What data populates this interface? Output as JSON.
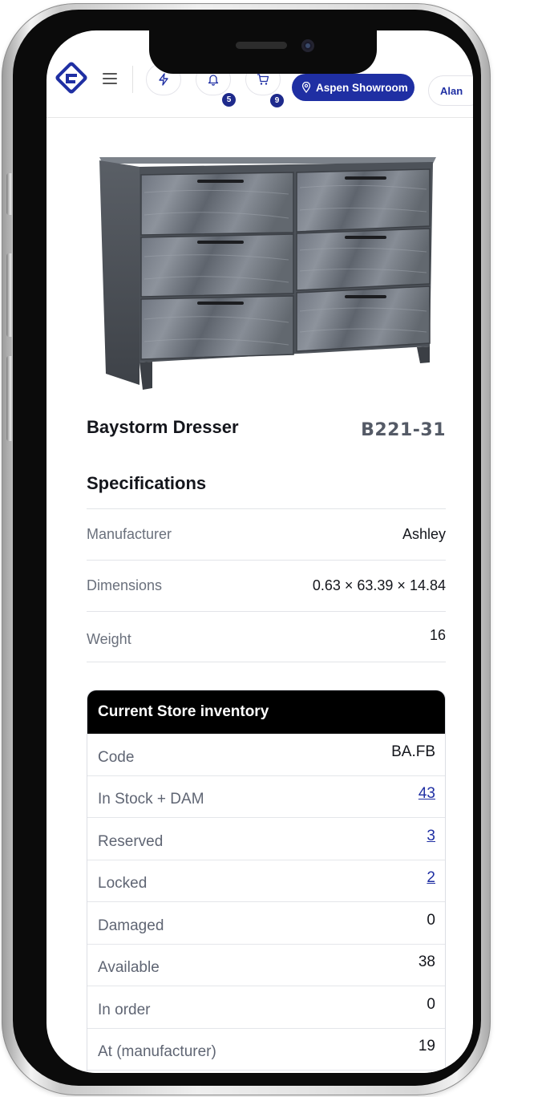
{
  "topbar": {
    "showroom_label": "Aspen Showroom",
    "user_label": "Alan",
    "notifications_count": "5",
    "cart_count": "9"
  },
  "product": {
    "name": "Baystorm Dresser",
    "code": "B221-31"
  },
  "specifications": {
    "title": "Specifications",
    "rows": [
      {
        "label": "Manufacturer",
        "value": "Ashley"
      },
      {
        "label": "Dimensions",
        "value": "0.63 × 63.39 × 14.84"
      },
      {
        "label": "Weight",
        "value": "16"
      }
    ]
  },
  "inventory": {
    "title": "Current Store inventory",
    "rows": [
      {
        "label": "Code",
        "value": "BA.FB"
      },
      {
        "label": "In Stock + DAM",
        "value": "43"
      },
      {
        "label": "Reserved",
        "value": "3"
      },
      {
        "label": "Locked",
        "value": "2"
      },
      {
        "label": "Damaged",
        "value": "0"
      },
      {
        "label": "Available",
        "value": "38"
      },
      {
        "label": "In order",
        "value": "0"
      },
      {
        "label": "At (manufacturer)",
        "value": "19"
      }
    ]
  },
  "colors": {
    "brand_blue": "#1f2fa3",
    "badge_blue": "#1e2a8c",
    "header_black": "#000000"
  },
  "icons": [
    "brand-logo-icon",
    "menu-icon",
    "bolt-icon",
    "bell-icon",
    "cart-icon",
    "location-pin-icon"
  ]
}
